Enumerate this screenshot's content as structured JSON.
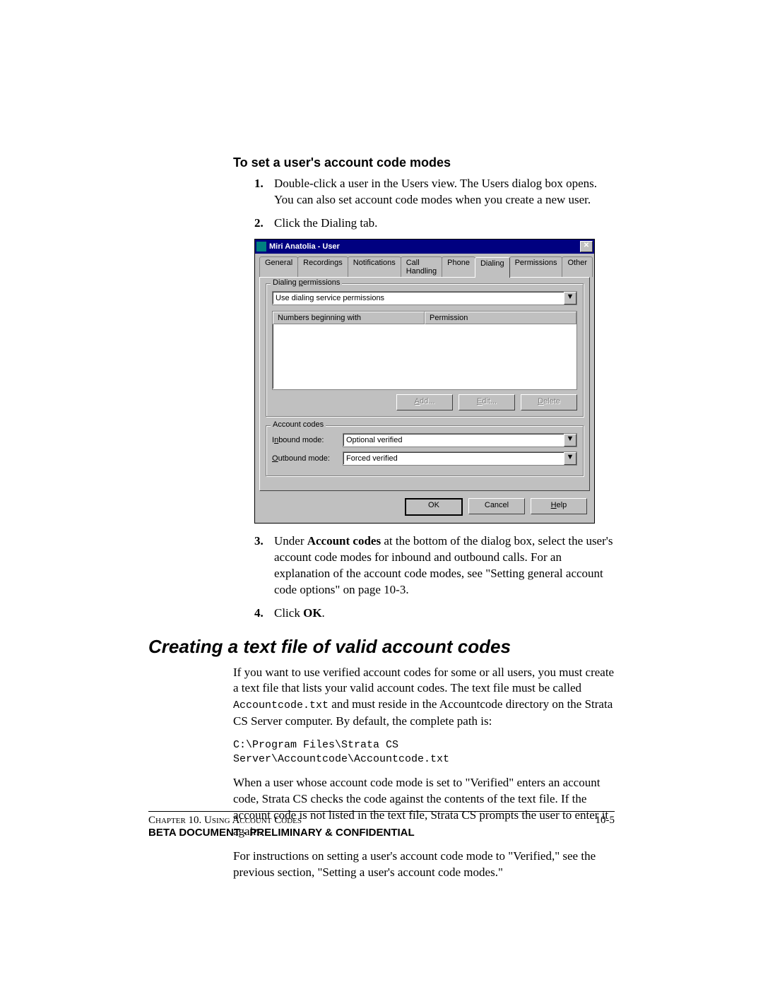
{
  "section_title": "To set a user's account code modes",
  "steps": {
    "s1": {
      "num": "1.",
      "text": "Double-click a user in the Users view. The Users dialog box opens. You can also set account code modes when you create a new user."
    },
    "s2": {
      "num": "2.",
      "text": "Click the Dialing tab."
    },
    "s3": {
      "num": "3.",
      "prefix": "Under ",
      "b1": "Account codes",
      "rest": " at the bottom of the dialog box, select the user's account code modes for inbound and outbound calls. For an explanation of the account code modes, see \"Setting general account code options\" on page 10-3."
    },
    "s4": {
      "num": "4.",
      "prefix": "Click ",
      "b1": "OK",
      "suffix": "."
    }
  },
  "dialog": {
    "title": "Miri Anatolia - User",
    "close": "✕",
    "tabs": [
      "General",
      "Recordings",
      "Notifications",
      "Call Handling",
      "Phone",
      "Dialing",
      "Permissions",
      "Other"
    ],
    "active_tab_index": 5,
    "group_dialing": {
      "legend_pre": "Dialing ",
      "legend_key": "p",
      "legend_post": "ermissions",
      "dropdown": "Use dialing service permissions",
      "col1": "Numbers beginning with",
      "col2": "Permission",
      "btn_add_pre": "",
      "btn_add_key": "A",
      "btn_add_post": "dd...",
      "btn_edit_pre": "",
      "btn_edit_key": "E",
      "btn_edit_post": "dit...",
      "btn_del_pre": "",
      "btn_del_key": "D",
      "btn_del_post": "elete"
    },
    "group_codes": {
      "legend": "Account codes",
      "inbound_label_pre": "I",
      "inbound_label_key": "n",
      "inbound_label_post": "bound mode:",
      "inbound_value": "Optional verified",
      "outbound_label_pre": "",
      "outbound_label_key": "O",
      "outbound_label_post": "utbound mode:",
      "outbound_value": "Forced verified"
    },
    "footer": {
      "ok": "OK",
      "cancel": "Cancel",
      "help_key": "H",
      "help_post": "elp"
    }
  },
  "heading2": "Creating a text file of valid account codes",
  "para1_a": "If you want to use verified account codes for some or all users, you must create a text file that lists your valid account codes. The text file must be called ",
  "para1_code": "Accountcode.txt",
  "para1_b": " and must reside in the Accountcode directory on the Strata CS Server computer. By default, the complete path is:",
  "path_line": "C:\\Program Files\\Strata CS Server\\Accountcode\\Accountcode.txt",
  "para2": "When a user whose account code mode is set to \"Verified\" enters an account code, Strata CS checks the code against the contents of the text file. If the account code is not listed in the text file, Strata CS prompts the user to enter it again.",
  "para3": "For instructions on setting a user's account code mode to \"Verified,\" see the previous section, \"Setting a user's account code modes.\"",
  "footer": {
    "chapter": "Chapter 10.  Using Account Codes",
    "pagenum": "10-5",
    "confidential": "BETA DOCUMENT - PRELIMINARY & CONFIDENTIAL"
  }
}
